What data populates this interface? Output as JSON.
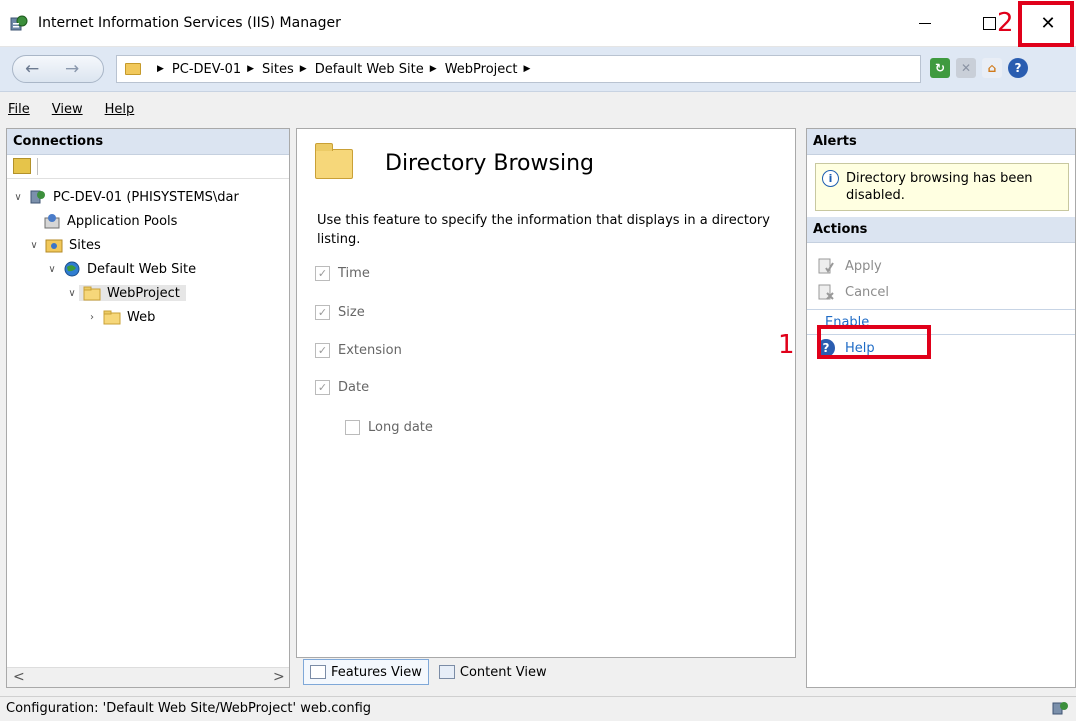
{
  "window": {
    "title": "Internet Information Services (IIS) Manager",
    "minimize_glyph": "—",
    "close_glyph": "✕"
  },
  "annotations": [
    {
      "label": "1",
      "target": "Enable"
    },
    {
      "label": "2",
      "target": "close-button"
    }
  ],
  "address": {
    "back_glyph": "←",
    "forward_glyph": "→",
    "breadcrumbs": [
      "PC-DEV-01",
      "Sites",
      "Default Web Site",
      "WebProject"
    ],
    "separator": "▶"
  },
  "menu": {
    "items": [
      {
        "label": "File",
        "accel": "F"
      },
      {
        "label": "View",
        "accel": "V"
      },
      {
        "label": "Help",
        "accel": "H"
      }
    ]
  },
  "connections": {
    "header": "Connections",
    "tree": [
      {
        "label": "PC-DEV-01 (PHISYSTEMS\\dar",
        "level": 0,
        "twisty": "∨",
        "icon": "server-icon"
      },
      {
        "label": "Application Pools",
        "level": 1,
        "twisty": "",
        "icon": "app-pools-icon"
      },
      {
        "label": "Sites",
        "level": 1,
        "twisty": "∨",
        "icon": "sites-icon"
      },
      {
        "label": "Default Web Site",
        "level": 2,
        "twisty": "∨",
        "icon": "globe-icon"
      },
      {
        "label": "WebProject",
        "level": 3,
        "twisty": "∨",
        "icon": "folder-icon",
        "selected": true
      },
      {
        "label": "Web",
        "level": 4,
        "twisty": "›",
        "icon": "folder-icon"
      }
    ],
    "scroll_left": "<",
    "scroll_right": ">"
  },
  "feature": {
    "title": "Directory Browsing",
    "description": "Use this feature to specify the information that displays in a directory listing.",
    "options": [
      {
        "label": "Time",
        "checked": true
      },
      {
        "label": "Size",
        "checked": true
      },
      {
        "label": "Extension",
        "checked": true
      },
      {
        "label": "Date",
        "checked": true
      },
      {
        "label": "Long date",
        "checked": false
      }
    ],
    "tabs": {
      "features_view": "Features View",
      "content_view": "Content View"
    }
  },
  "actions": {
    "alerts_header": "Alerts",
    "alert_text": "Directory browsing has been disabled.",
    "actions_header": "Actions",
    "apply": "Apply",
    "cancel": "Cancel",
    "enable": "Enable",
    "help": "Help"
  },
  "status": {
    "text": "Configuration: 'Default Web Site/WebProject' web.config"
  }
}
